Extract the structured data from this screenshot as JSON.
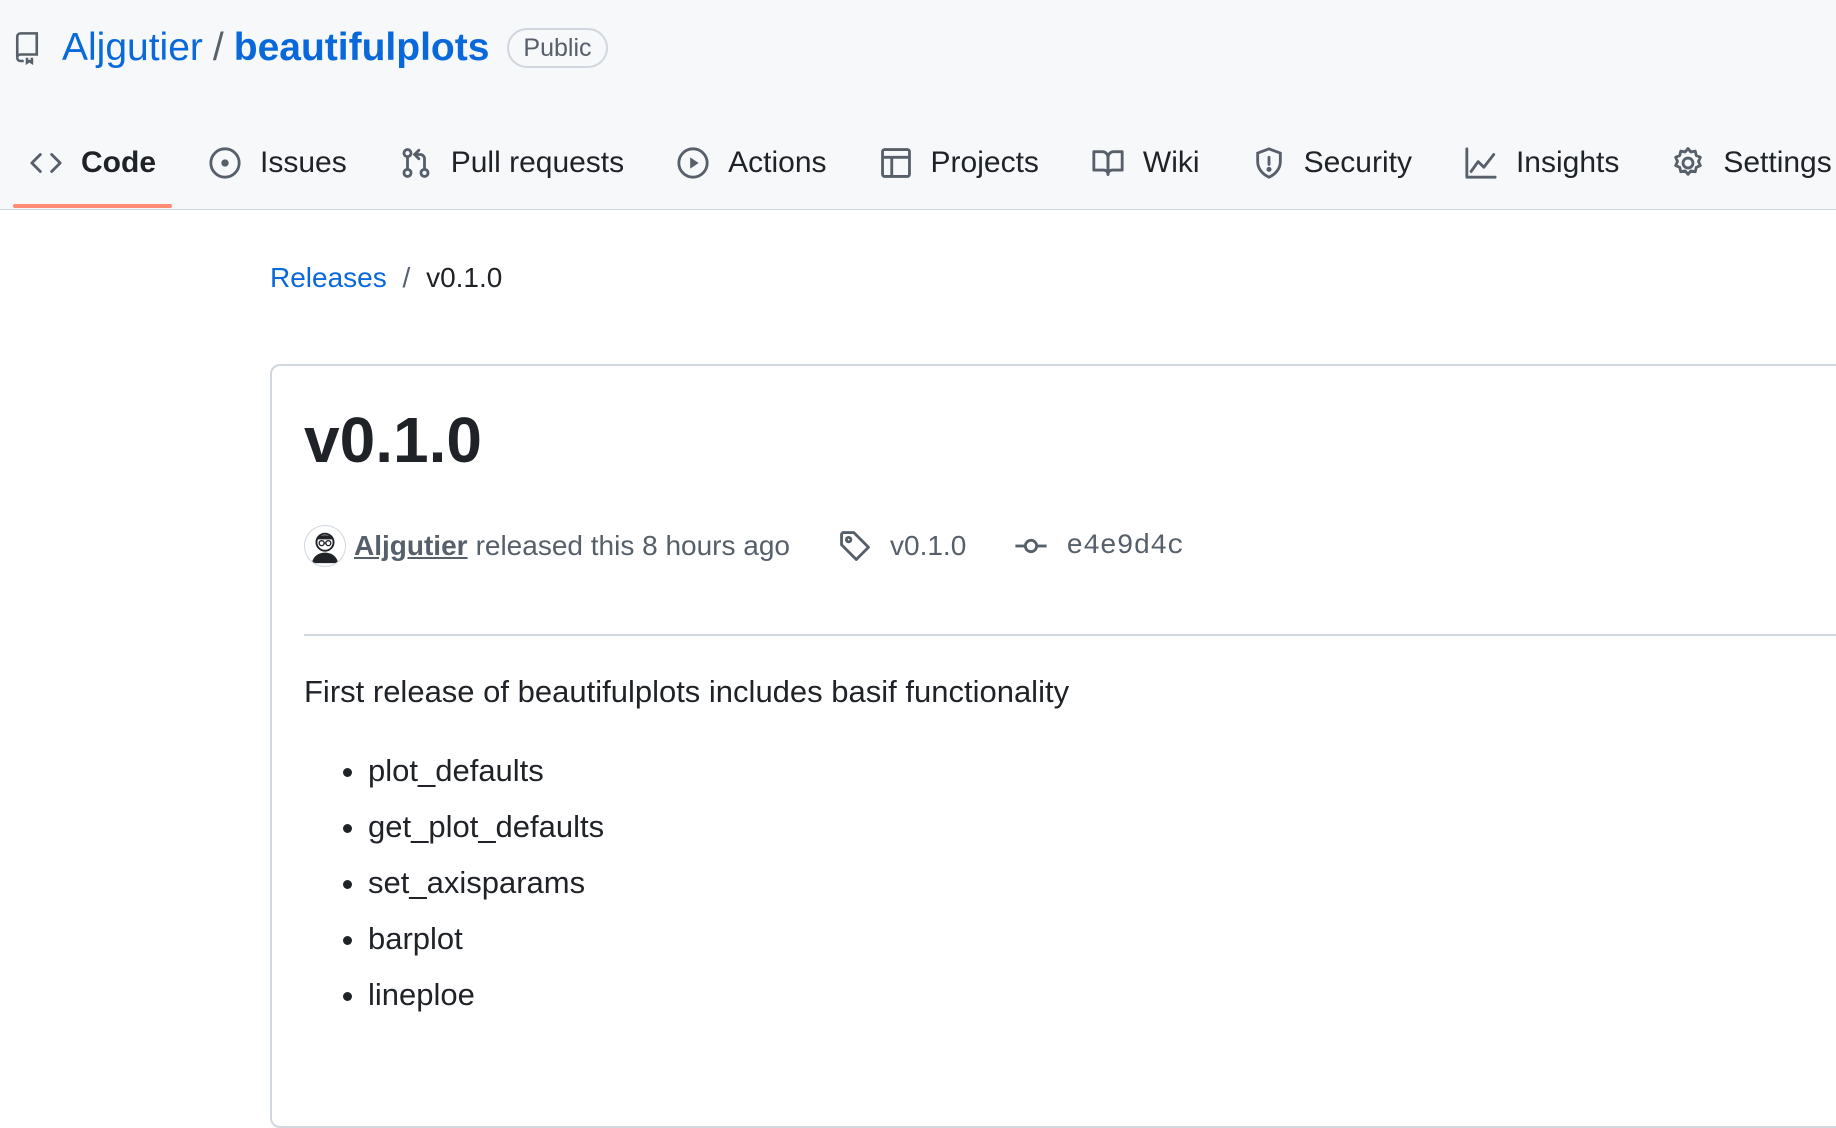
{
  "repo": {
    "owner": "Aljgutier",
    "separator": "/",
    "name": "beautifulplots",
    "visibility": "Public"
  },
  "tabs": [
    {
      "label": "Code",
      "icon": "code-icon",
      "active": true
    },
    {
      "label": "Issues",
      "icon": "issue-opened-icon",
      "active": false
    },
    {
      "label": "Pull requests",
      "icon": "git-pull-request-icon",
      "active": false
    },
    {
      "label": "Actions",
      "icon": "play-icon",
      "active": false
    },
    {
      "label": "Projects",
      "icon": "table-icon",
      "active": false
    },
    {
      "label": "Wiki",
      "icon": "book-icon",
      "active": false
    },
    {
      "label": "Security",
      "icon": "shield-icon",
      "active": false
    },
    {
      "label": "Insights",
      "icon": "graph-icon",
      "active": false
    },
    {
      "label": "Settings",
      "icon": "gear-icon",
      "active": false
    }
  ],
  "breadcrumb": {
    "parent": "Releases",
    "separator": "/",
    "current": "v0.1.0"
  },
  "release": {
    "title": "v0.1.0",
    "author": "Aljgutier",
    "released_text": "released this 8 hours ago",
    "tag": "v0.1.0",
    "commit": "e4e9d4c",
    "notes_intro": "First release of beautifulplots includes basif functionality",
    "notes_items": [
      "plot_defaults",
      "get_plot_defaults",
      "set_axisparams",
      "barplot",
      "lineploe"
    ]
  },
  "colors": {
    "link": "#0969da",
    "text": "#1f2328",
    "muted": "#57606a",
    "border": "#d0d7de",
    "header_bg": "#f6f8fa",
    "active_tab_underline": "#fd8c73"
  }
}
